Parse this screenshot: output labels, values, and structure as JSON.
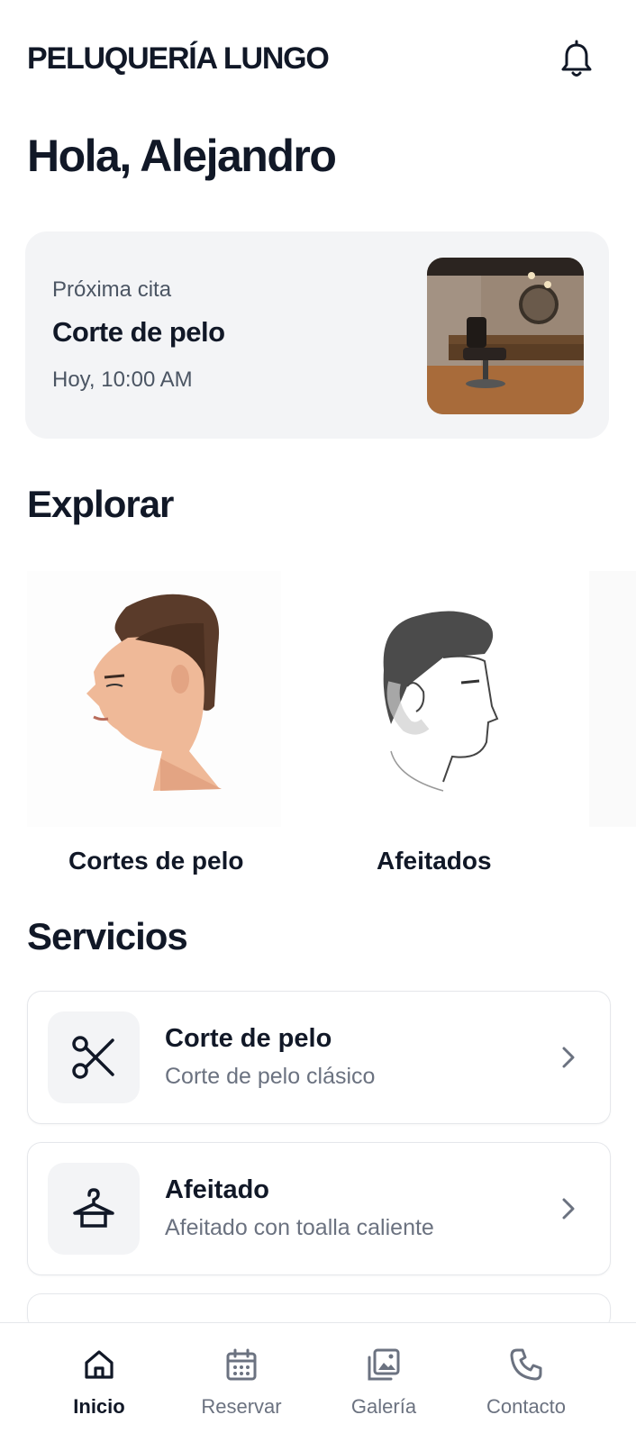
{
  "header": {
    "brand": "PELUQUERÍA LUNGO",
    "notifications_icon": "bell-icon"
  },
  "greeting": "Hola, Alejandro",
  "next_appointment": {
    "kicker": "Próxima cita",
    "service": "Corte de pelo",
    "time": "Hoy, 10:00 AM"
  },
  "explore": {
    "title": "Explorar",
    "items": [
      {
        "label": "Cortes de pelo"
      },
      {
        "label": "Afeitados"
      }
    ]
  },
  "services": {
    "title": "Servicios",
    "items": [
      {
        "title": "Corte de pelo",
        "subtitle": "Corte de pelo clásico",
        "icon": "scissors-icon"
      },
      {
        "title": "Afeitado",
        "subtitle": "Afeitado con toalla caliente",
        "icon": "hanger-icon"
      }
    ]
  },
  "tabbar": {
    "items": [
      {
        "label": "Inicio",
        "icon": "home-icon",
        "active": true
      },
      {
        "label": "Reservar",
        "icon": "calendar-icon",
        "active": false
      },
      {
        "label": "Galería",
        "icon": "gallery-icon",
        "active": false
      },
      {
        "label": "Contacto",
        "icon": "phone-icon",
        "active": false
      }
    ]
  },
  "colors": {
    "text": "#111827",
    "muted": "#6b7280",
    "card": "#f3f4f6",
    "border": "#e5e7eb"
  }
}
